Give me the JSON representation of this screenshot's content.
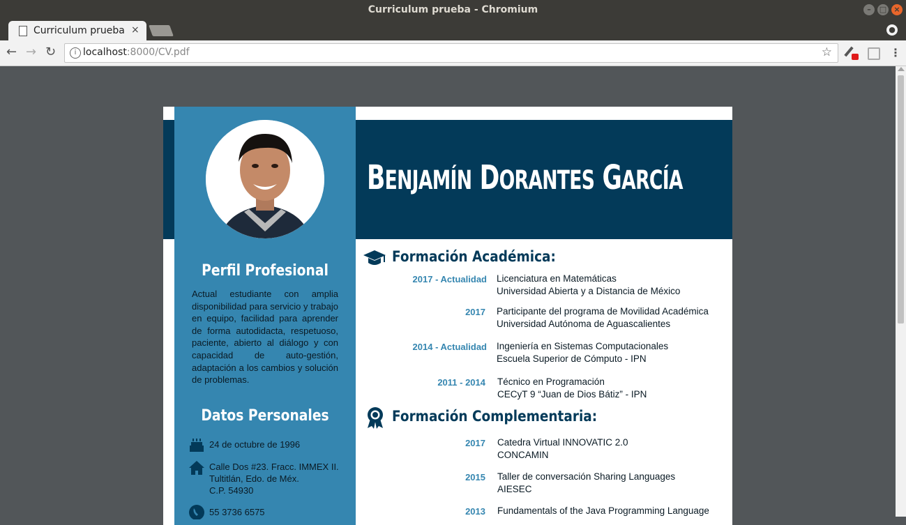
{
  "window": {
    "title": "Curriculum prueba - Chromium"
  },
  "tab": {
    "label": "Curriculum prueba",
    "close": "×"
  },
  "toolbar": {
    "back": "←",
    "forward": "→",
    "reload": "↻",
    "url_host": "localhost",
    "url_rest": ":8000/CV.pdf",
    "star": "☆",
    "menu": "⋮"
  },
  "cv": {
    "name_first_B": "B",
    "name_first_rest": "ENJAMÍN",
    "name_second_D": "D",
    "name_second_rest": "ORANTES",
    "name_third_G": "G",
    "name_third_rest": "ARCÍA",
    "perfil": {
      "heading": "Perfil Profesional",
      "text": "Actual estudiante con amplia disponibilidad para servicio y trabajo en equipo, facilidad para aprender de forma autodidacta, respetuoso, paciente, abierto al diálogo y con capacidad de auto-gestión, adaptación a los cambios y solución de problemas."
    },
    "datos": {
      "heading": "Datos Personales",
      "birthday": "24 de octubre de 1996",
      "address_1": "Calle Dos #23. Fracc. IMMEX II.",
      "address_2": "Tultitlán, Edo. de Méx.",
      "address_3": "C.P. 54930",
      "phone": "55 3736 6575"
    },
    "academica": {
      "heading": "Formación Académica:",
      "entries": [
        {
          "date": "2017 - Actualidad",
          "line1": "Licenciatura en Matemáticas",
          "line2": "Universidad Abierta y a Distancia de México"
        },
        {
          "date": "2017",
          "line1": "Participante del programa de Movilidad Académica",
          "line2": "Universidad Autónoma de Aguascalientes"
        },
        {
          "date": "2014 - Actualidad",
          "line1": "Ingeniería en Sistemas Computacionales",
          "line2": "Escuela Superior de Cómputo - IPN"
        },
        {
          "date": "2011 - 2014",
          "line1": "Técnico en Programación",
          "line2": "CECyT 9 “Juan de Dios Bátiz” - IPN"
        }
      ]
    },
    "complementaria": {
      "heading": "Formación Complementaria:",
      "entries": [
        {
          "date": "2017",
          "line1": "Catedra Virtual INNOVATIC 2.0",
          "line2": "CONCAMIN"
        },
        {
          "date": "2015",
          "line1": "Taller de conversación Sharing Languages",
          "line2": "AIESEC"
        },
        {
          "date": "2013",
          "line1": "Fundamentals of the Java Programming Language",
          "line2": ""
        }
      ]
    }
  }
}
